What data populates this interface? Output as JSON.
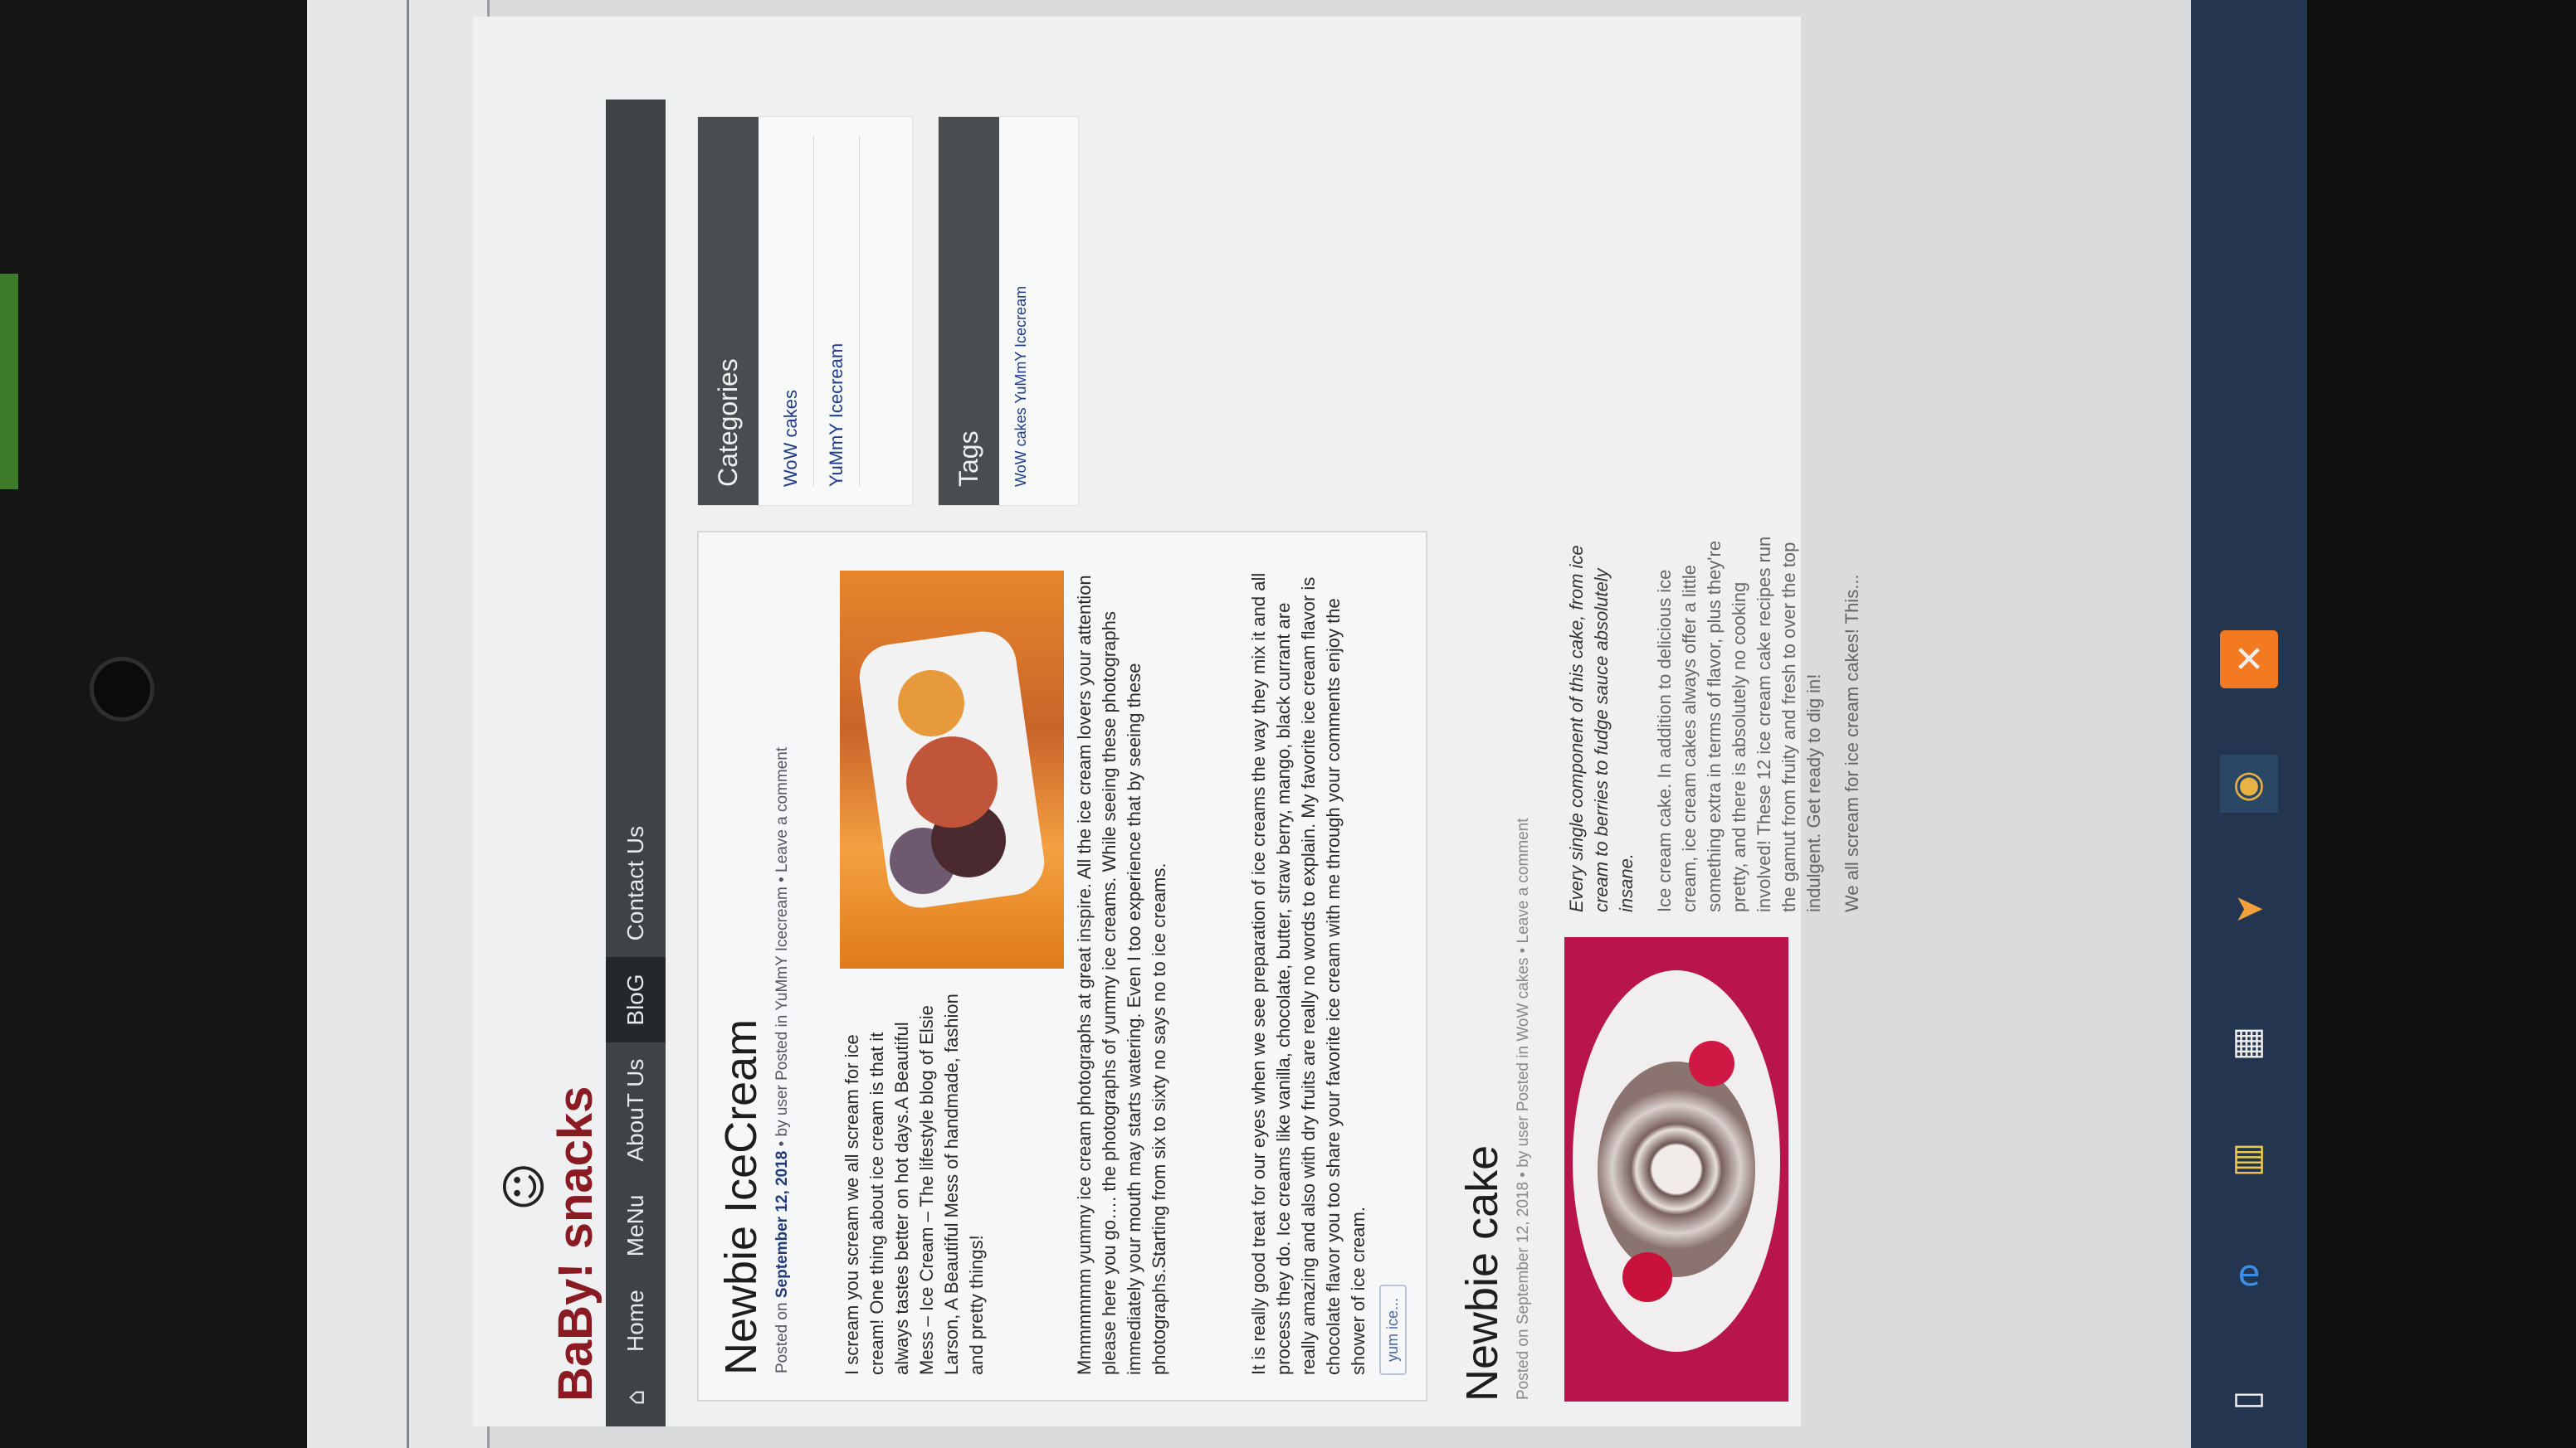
{
  "site": {
    "logo_smiley": "☺",
    "brand": "BaBy! snacks"
  },
  "nav": {
    "home_icon": "home-icon",
    "items": [
      "Home",
      "MeNu",
      "AbouT Us",
      "BloG",
      "Contact Us"
    ],
    "active": "BloG"
  },
  "post1": {
    "title": "Newbie IceCream",
    "meta_prefix": "Posted on",
    "meta_date": "September 12, 2018",
    "meta_rest": "• by user Posted in YuMmY Icecream • Leave a comment",
    "p1": "I scream you scream we all scream for ice cream! One thing about ice cream is that it always tastes better on hot days.A Beautiful Mess – Ice Cream – The lifestyle blog of Elsie Larson, A Beautiful Mess of handmade, fashion and pretty things!",
    "p2": "Mmmmmmm yummy ice cream photographs at great inspire. All the ice cream lovers your attention please here you go…. the photographs of yummy ice creams. While seeing these photographs immediately your mouth may starts watering. Even I too experience that by seeing these photographs.Starting from six to sixty no says no to ice creams.",
    "p3": "It is really good treat for our eyes when we see preparation of ice creams the way they mix it and all process they do. Ice creams like vanilla, chocolate, butter, straw berry, mango, black currant are really amazing and also with dry fruits are really no words to explain. My favorite ice cream flavor is chocolate flavor you too share your favorite ice cream with me through your comments enjoy the shower of ice cream.",
    "tag": "yum ice..."
  },
  "post2": {
    "title": "Newbie cake",
    "meta": "Posted on September 12, 2018 • by user Posted in WoW cakes • Leave a comment",
    "lead": "Every single component of this cake, from ice cream to berries to fudge sauce absolutely insane.",
    "body": "Ice cream cake. In addition to delicious ice cream, ice cream cakes always offer a little something extra in terms of flavor, plus they're pretty, and there is absolutely no cooking involved! These 12 ice cream cake recipes run the gamut from fruity and fresh to over the top indulgent. Get ready to dig in!",
    "tail": "We all scream for ice cream cakes! This..."
  },
  "sidebar": {
    "categories": {
      "title": "Categories",
      "items": [
        "WoW cakes",
        "YuMmY Icecream"
      ]
    },
    "tags": {
      "title": "Tags",
      "cloud": "WoW cakes YuMmY Icecream"
    }
  },
  "taskbar": {
    "icons": [
      "task-view-icon",
      "edge-icon",
      "file-explorer-icon",
      "store-icon",
      "paper-plane-icon",
      "chrome-icon",
      "xampp-icon"
    ]
  },
  "colors": {
    "brand_red": "#8a1b22",
    "nav_bg": "#3e4446",
    "link_blue": "#1f3a8a",
    "taskbar": "#24364f"
  }
}
